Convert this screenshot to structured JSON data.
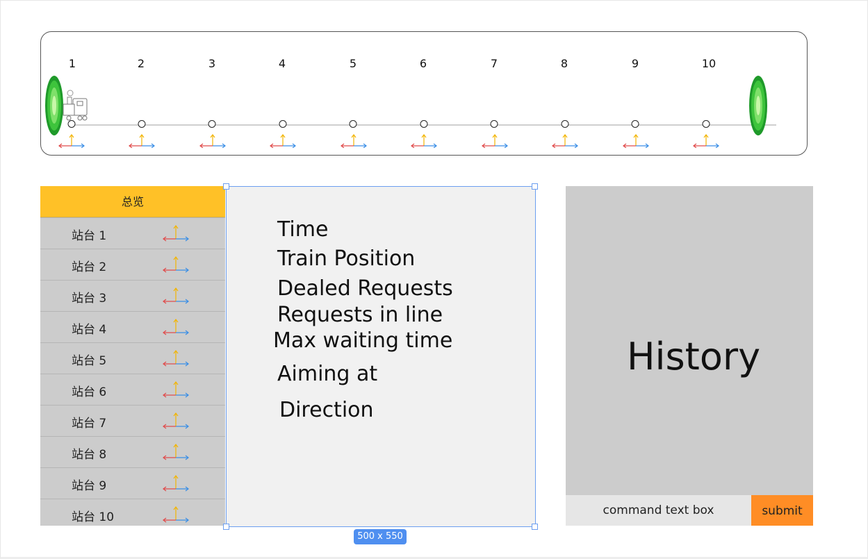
{
  "track": {
    "station_numbers": [
      "1",
      "2",
      "3",
      "4",
      "5",
      "6",
      "7",
      "8",
      "9",
      "10"
    ]
  },
  "list": {
    "header": "总览",
    "stations": [
      "站台 1",
      "站台 2",
      "站台 3",
      "站台 4",
      "站台 5",
      "站台 6",
      "站台 7",
      "站台 8",
      "站台 9",
      "站台 10"
    ]
  },
  "info": {
    "time": "Time",
    "train_position": "Train Position",
    "dealed_requests": "Dealed Requests",
    "requests_in_line": "Requests in line",
    "max_waiting_time": "Max waiting time",
    "aiming_at": "Aiming at",
    "direction": "Direction",
    "size_badge": "500 x 550"
  },
  "history": {
    "title": "History",
    "command_placeholder": "command text box",
    "submit_label": "submit"
  },
  "colors": {
    "header_yellow": "#ffc127",
    "submit_orange": "#ff8d25",
    "selection_blue": "#4f8ff0",
    "arrow_left_red": "#e04b4b",
    "arrow_right_blue": "#3a8ee6",
    "arrow_up_yellow": "#f2b400",
    "portal_green": "#2fb52f"
  },
  "icons": [
    "portal-icon",
    "train-icon",
    "direction-arrows-icon"
  ]
}
